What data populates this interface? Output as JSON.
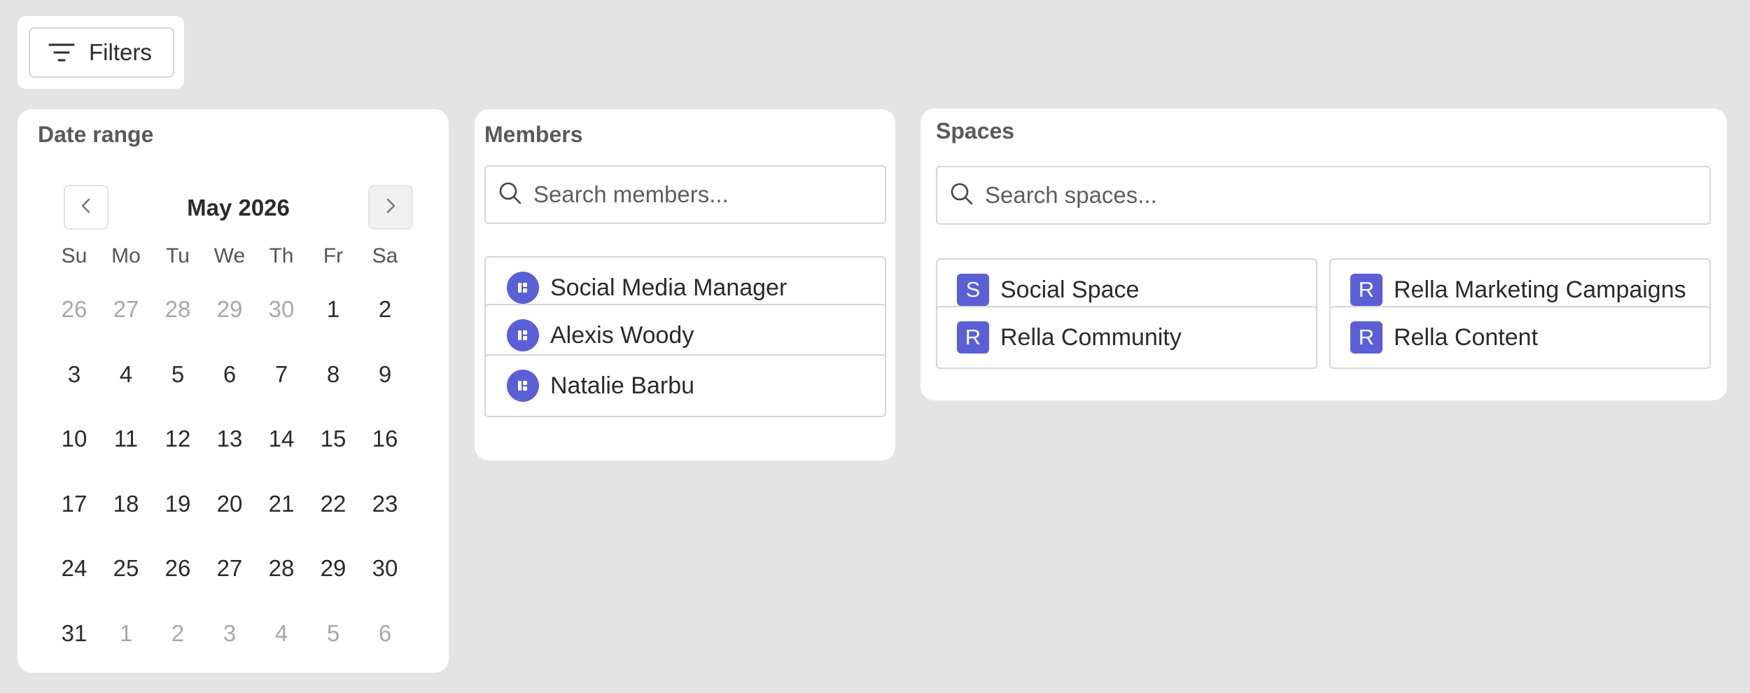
{
  "filters": {
    "label": "Filters",
    "icon": "filter-lines-icon"
  },
  "date_range": {
    "title": "Date range",
    "month_label": "May 2026",
    "weekdays": [
      "Su",
      "Mo",
      "Tu",
      "We",
      "Th",
      "Fr",
      "Sa"
    ],
    "weeks": [
      [
        {
          "d": "26",
          "muted": true
        },
        {
          "d": "27",
          "muted": true
        },
        {
          "d": "28",
          "muted": true
        },
        {
          "d": "29",
          "muted": true
        },
        {
          "d": "30",
          "muted": true
        },
        {
          "d": "1",
          "muted": false
        },
        {
          "d": "2",
          "muted": false
        }
      ],
      [
        {
          "d": "3",
          "muted": false
        },
        {
          "d": "4",
          "muted": false
        },
        {
          "d": "5",
          "muted": false
        },
        {
          "d": "6",
          "muted": false
        },
        {
          "d": "7",
          "muted": false
        },
        {
          "d": "8",
          "muted": false
        },
        {
          "d": "9",
          "muted": false
        }
      ],
      [
        {
          "d": "10",
          "muted": false
        },
        {
          "d": "11",
          "muted": false
        },
        {
          "d": "12",
          "muted": false
        },
        {
          "d": "13",
          "muted": false
        },
        {
          "d": "14",
          "muted": false
        },
        {
          "d": "15",
          "muted": false
        },
        {
          "d": "16",
          "muted": false
        }
      ],
      [
        {
          "d": "17",
          "muted": false
        },
        {
          "d": "18",
          "muted": false
        },
        {
          "d": "19",
          "muted": false
        },
        {
          "d": "20",
          "muted": false
        },
        {
          "d": "21",
          "muted": false
        },
        {
          "d": "22",
          "muted": false
        },
        {
          "d": "23",
          "muted": false
        }
      ],
      [
        {
          "d": "24",
          "muted": false
        },
        {
          "d": "25",
          "muted": false
        },
        {
          "d": "26",
          "muted": false
        },
        {
          "d": "27",
          "muted": false
        },
        {
          "d": "28",
          "muted": false
        },
        {
          "d": "29",
          "muted": false
        },
        {
          "d": "30",
          "muted": false
        }
      ],
      [
        {
          "d": "31",
          "muted": false
        },
        {
          "d": "1",
          "muted": true
        },
        {
          "d": "2",
          "muted": true
        },
        {
          "d": "3",
          "muted": true
        },
        {
          "d": "4",
          "muted": true
        },
        {
          "d": "5",
          "muted": true
        },
        {
          "d": "6",
          "muted": true
        }
      ]
    ]
  },
  "members": {
    "title": "Members",
    "search_placeholder": "Search members...",
    "items": [
      {
        "name": "Social Media Manager"
      },
      {
        "name": "Alexis Woody"
      },
      {
        "name": "Natalie Barbu"
      }
    ]
  },
  "spaces": {
    "title": "Spaces",
    "search_placeholder": "Search spaces...",
    "items": [
      {
        "letter": "S",
        "name": "Social Space"
      },
      {
        "letter": "R",
        "name": "Rella Marketing Campaigns"
      },
      {
        "letter": "R",
        "name": "Rella Community"
      },
      {
        "letter": "R",
        "name": "Rella Content"
      }
    ]
  },
  "colors": {
    "accent": "#5b5fd6",
    "background": "#e4e4e4",
    "panel": "#ffffff",
    "muted_text": "#a8a8a8"
  }
}
